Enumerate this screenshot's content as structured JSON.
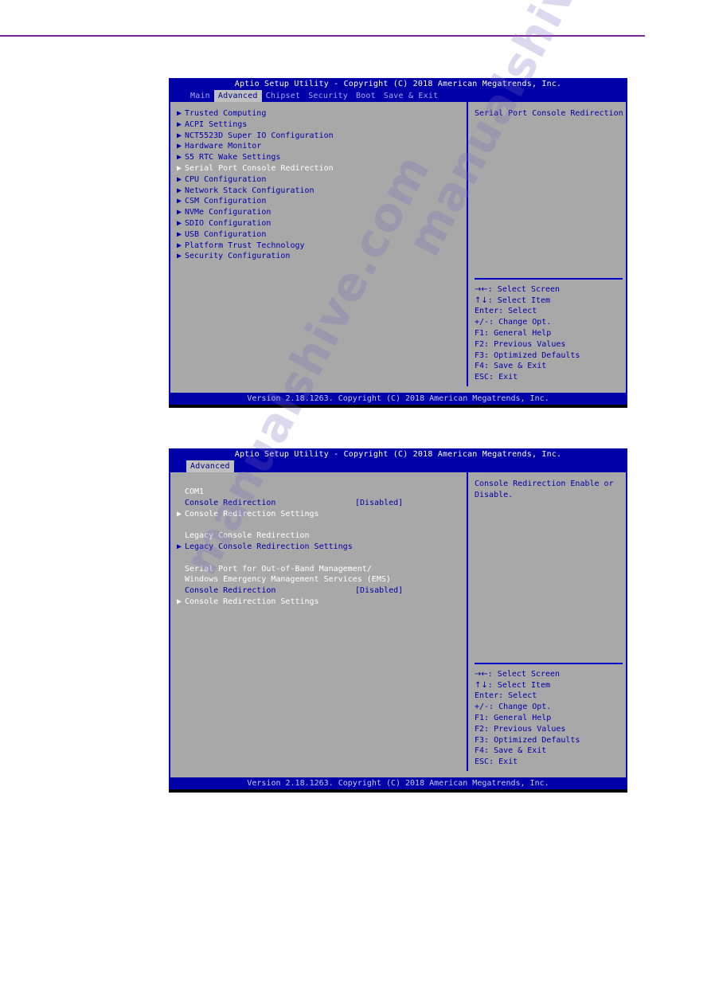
{
  "page": {
    "rule_color": "#7b2a96",
    "watermark": "manualshive.com"
  },
  "screens": [
    {
      "id": "screen-advanced-menu",
      "title": "Aptio Setup Utility - Copyright (C) 2018 American Megatrends, Inc.",
      "tabs": [
        {
          "label": "Main",
          "active": false
        },
        {
          "label": "Advanced",
          "active": true
        },
        {
          "label": "Chipset",
          "active": false
        },
        {
          "label": "Security",
          "active": false
        },
        {
          "label": "Boot",
          "active": false
        },
        {
          "label": "Save & Exit",
          "active": false
        }
      ],
      "menu_items": [
        {
          "label": "Trusted Computing",
          "selected": false
        },
        {
          "label": "ACPI Settings",
          "selected": false
        },
        {
          "label": "NCT5523D Super IO Configuration",
          "selected": false
        },
        {
          "label": "Hardware Monitor",
          "selected": false
        },
        {
          "label": "S5 RTC Wake Settings",
          "selected": false
        },
        {
          "label": "Serial Port Console Redirection",
          "selected": true
        },
        {
          "label": "CPU Configuration",
          "selected": false
        },
        {
          "label": "Network Stack Configuration",
          "selected": false
        },
        {
          "label": "CSM Configuration",
          "selected": false
        },
        {
          "label": "NVMe Configuration",
          "selected": false
        },
        {
          "label": "SDIO Configuration",
          "selected": false
        },
        {
          "label": "USB Configuration",
          "selected": false
        },
        {
          "label": "Platform Trust Technology",
          "selected": false
        },
        {
          "label": "Security Configuration",
          "selected": false
        }
      ],
      "help_lines": [
        "Serial Port Console Redirection"
      ],
      "keys": [
        {
          "glyph": "→←",
          "text": ": Select Screen"
        },
        {
          "glyph": "↑↓",
          "text": ": Select Item"
        },
        {
          "glyph": "",
          "text": "Enter: Select"
        },
        {
          "glyph": "",
          "text": "+/-: Change Opt."
        },
        {
          "glyph": "",
          "text": "F1: General Help"
        },
        {
          "glyph": "",
          "text": "F2: Previous Values"
        },
        {
          "glyph": "",
          "text": "F3: Optimized Defaults"
        },
        {
          "glyph": "",
          "text": "F4: Save & Exit"
        },
        {
          "glyph": "",
          "text": "ESC: Exit"
        }
      ],
      "footer": "Version 2.18.1263. Copyright (C) 2018 American Megatrends, Inc."
    },
    {
      "id": "screen-console-redirection",
      "title": "Aptio Setup Utility - Copyright (C) 2018 American Megatrends, Inc.",
      "tabs": [
        {
          "label": "Advanced",
          "active": true
        }
      ],
      "rows": [
        {
          "kind": "heading",
          "label": "COM1"
        },
        {
          "kind": "option",
          "label": "Console Redirection",
          "value": "[Disabled]"
        },
        {
          "kind": "submenu",
          "label": "Console Redirection Settings",
          "selected": true
        },
        {
          "kind": "spacer"
        },
        {
          "kind": "heading",
          "label": "Legacy Console Redirection"
        },
        {
          "kind": "submenu",
          "label": "Legacy Console Redirection Settings",
          "selected": false
        },
        {
          "kind": "spacer"
        },
        {
          "kind": "heading",
          "label": "Serial Port for Out-of-Band Management/"
        },
        {
          "kind": "heading",
          "label": "Windows Emergency Management Services (EMS)"
        },
        {
          "kind": "option",
          "label": "Console Redirection",
          "value": "[Disabled]"
        },
        {
          "kind": "submenu",
          "label": "Console Redirection Settings",
          "selected": true
        }
      ],
      "help_lines": [
        "Console Redirection Enable or",
        "Disable."
      ],
      "keys": [
        {
          "glyph": "→←",
          "text": ": Select Screen"
        },
        {
          "glyph": "↑↓",
          "text": ": Select Item"
        },
        {
          "glyph": "",
          "text": "Enter: Select"
        },
        {
          "glyph": "",
          "text": "+/-: Change Opt."
        },
        {
          "glyph": "",
          "text": "F1: General Help"
        },
        {
          "glyph": "",
          "text": "F2: Previous Values"
        },
        {
          "glyph": "",
          "text": "F3: Optimized Defaults"
        },
        {
          "glyph": "",
          "text": "F4: Save & Exit"
        },
        {
          "glyph": "",
          "text": "ESC: Exit"
        }
      ],
      "footer": "Version 2.18.1263. Copyright (C) 2018 American Megatrends, Inc."
    }
  ]
}
